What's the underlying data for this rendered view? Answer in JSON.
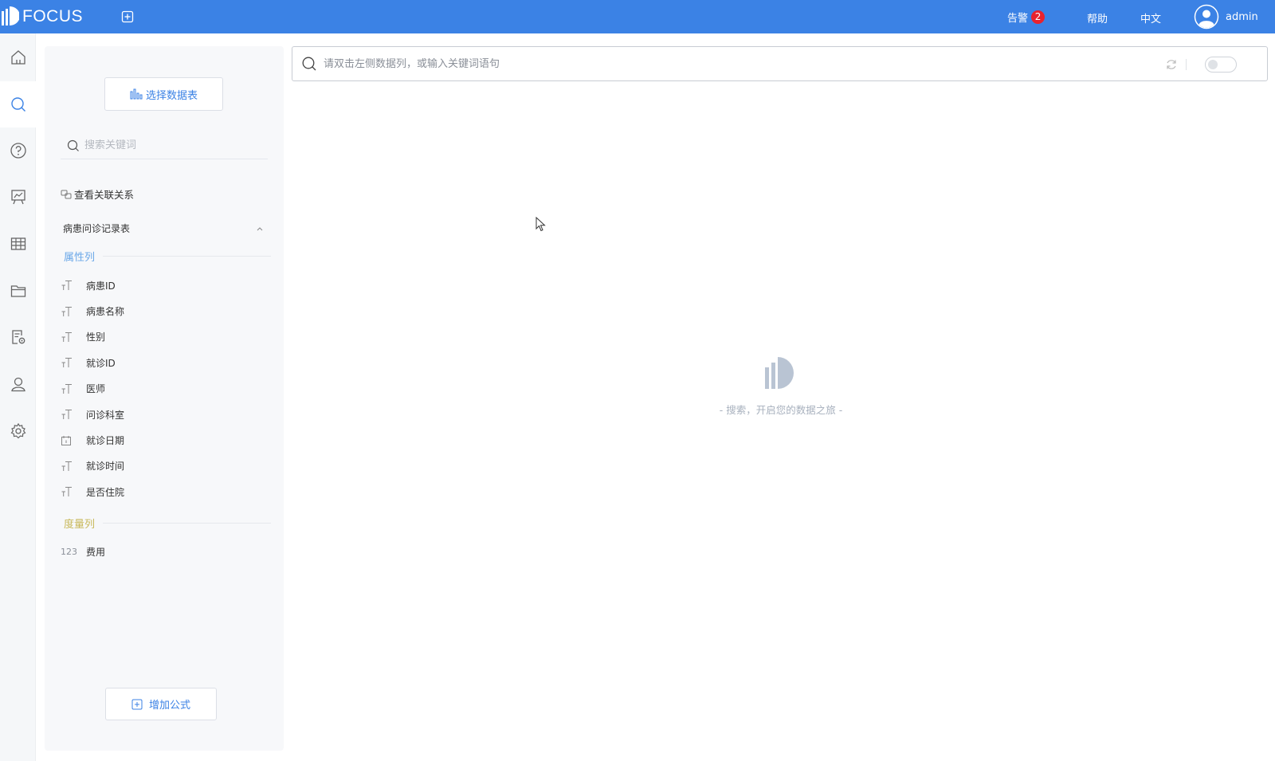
{
  "header": {
    "logo_text": "FOCUS",
    "alarm_label": "告警",
    "alarm_count": "2",
    "help_label": "帮助",
    "language_label": "中文",
    "user_name": "admin"
  },
  "nav": {
    "items": [
      {
        "icon": "home-icon"
      },
      {
        "icon": "search-icon",
        "active": true
      },
      {
        "icon": "help-icon"
      },
      {
        "icon": "presentation-icon"
      },
      {
        "icon": "table-icon"
      },
      {
        "icon": "folder-icon"
      },
      {
        "icon": "data-settings-icon"
      },
      {
        "icon": "user-icon"
      },
      {
        "icon": "gear-icon"
      }
    ]
  },
  "panel": {
    "select_table_label": "选择数据表",
    "keyword_placeholder": "搜索关键词",
    "relation_label": "查看关联关系",
    "table_name": "病患问诊记录表",
    "attribute_section": "属性列",
    "measure_section": "度量列",
    "attribute_columns": [
      {
        "type": "text",
        "name": "病患ID"
      },
      {
        "type": "text",
        "name": "病患名称"
      },
      {
        "type": "text",
        "name": "性别"
      },
      {
        "type": "text",
        "name": "就诊ID"
      },
      {
        "type": "text",
        "name": "医师"
      },
      {
        "type": "text",
        "name": "问诊科室"
      },
      {
        "type": "date",
        "name": "就诊日期"
      },
      {
        "type": "text",
        "name": "就诊时间"
      },
      {
        "type": "text",
        "name": "是否住院"
      }
    ],
    "measure_columns": [
      {
        "type": "123",
        "name": "费用"
      }
    ],
    "add_formula_label": "增加公式"
  },
  "search": {
    "placeholder": "请双击左侧数据列，或输入关键词语句"
  },
  "empty_state": {
    "text": "- 搜索，开启您的数据之旅 -"
  },
  "colors": {
    "brand": "#3b82e5",
    "badge": "#e8222e",
    "attribute_accent": "#6aa7e8",
    "measure_accent": "#c8b85a"
  }
}
